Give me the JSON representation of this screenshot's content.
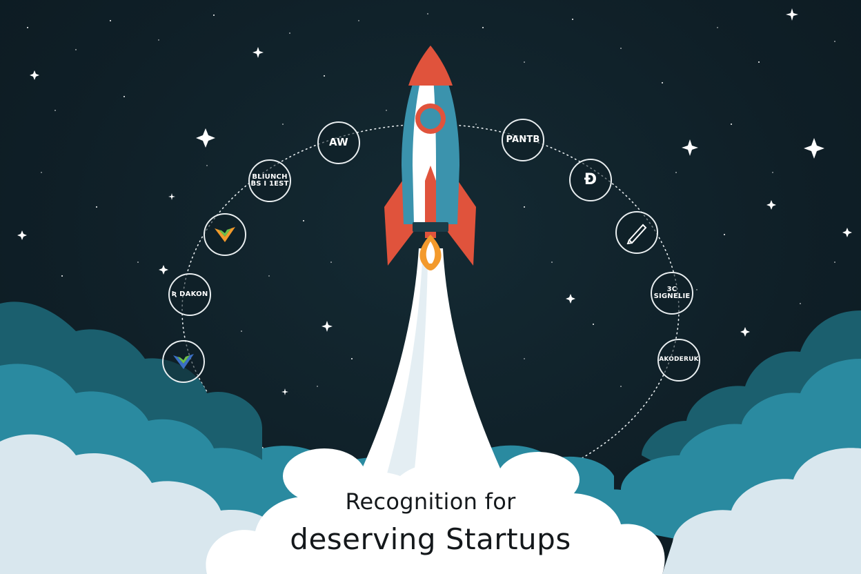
{
  "headline": {
    "line1": "Recognition for",
    "line2": "deserving Startups"
  },
  "logos": [
    {
      "id": "aw",
      "text": "AW",
      "icon": "arrow-mark-icon"
    },
    {
      "id": "blanch",
      "text": "BLIUNCH\nBS I 1EST"
    },
    {
      "id": "chevron-orange",
      "text": "",
      "icon": "chevron-mark-icon"
    },
    {
      "id": "dakon",
      "text": "Ʀ DAKON"
    },
    {
      "id": "chevron-green",
      "text": "",
      "icon": "chevron-mark-icon"
    },
    {
      "id": "pantb",
      "text": "PANTB"
    },
    {
      "id": "db",
      "text": "Ɖ"
    },
    {
      "id": "pen",
      "text": "",
      "icon": "pen-mark-icon"
    },
    {
      "id": "3c",
      "text": "3C\nSIGNELIE"
    },
    {
      "id": "akoderuk",
      "text": "AKODERUK"
    }
  ],
  "colors": {
    "sky": "#10202a",
    "cloud_dark": "#1b5f6e",
    "cloud_mid": "#2a8aa0",
    "cloud_light": "#d9e7ee",
    "rocket_red": "#e0533c",
    "rocket_blue": "#3b93ad",
    "flame": "#f39a2c"
  }
}
